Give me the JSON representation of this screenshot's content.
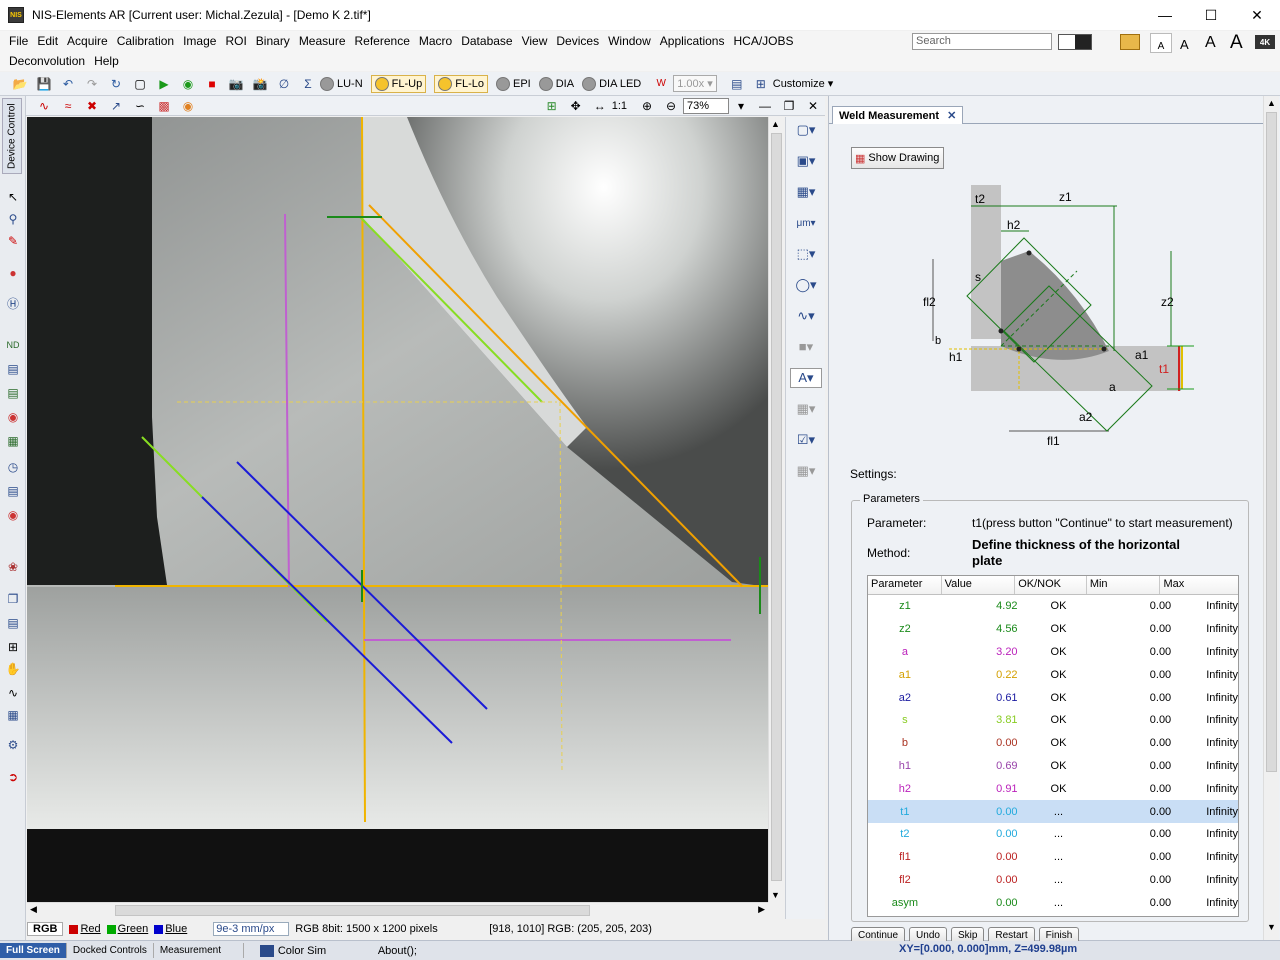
{
  "window": {
    "title": "NIS-Elements AR [Current user: Michal.Zezula]  - [Demo K 2.tif*]",
    "app_icon": "NIS"
  },
  "menu": {
    "row1": [
      "File",
      "Edit",
      "Acquire",
      "Calibration",
      "Image",
      "ROI",
      "Binary",
      "Measure",
      "Reference",
      "Macro",
      "Database",
      "View",
      "Devices",
      "Window",
      "Applications",
      "HCA/JOBS"
    ],
    "row2": [
      "Deconvolution",
      "Help"
    ],
    "search_placeholder": "Search",
    "font_sizes": [
      "A",
      "A",
      "A",
      "A"
    ],
    "badge_4k": "4K"
  },
  "toolbar1": {
    "lu_n": "LU-N",
    "fl_up": "FL-Up",
    "fl_lo": "FL-Lo",
    "epi": "EPI",
    "dia": "DIA",
    "dia_led": "DIA LED",
    "zoom_value": "1.00x",
    "customize": "Customize"
  },
  "toolbar2": {
    "one_to_one": "1:1",
    "zoom": "73%"
  },
  "left_tab": "Device Control",
  "image_status": {
    "channels": [
      "RGB",
      "Red",
      "Green",
      "Blue"
    ],
    "channel_colors": [
      "#000000",
      "#cc0000",
      "#00aa00",
      "#0000cc"
    ],
    "scale": "9e-3 mm/px",
    "info": "RGB 8bit: 1500 x 1200 pixels",
    "pixel": "[918, 1010] RGB: (205, 205, 203)"
  },
  "bottom_tabs": [
    "Full Screen",
    "Docked Controls",
    "Measurement"
  ],
  "bottom_status": {
    "color_sim": "Color Sim",
    "about": "About();"
  },
  "panel": {
    "tab": "Weld Measurement",
    "show_drawing": "Show Drawing",
    "settings_label": "Settings:",
    "params_legend": "Parameters",
    "parameter_label": "Parameter:",
    "parameter_value": "t1(press button \"Continue\" to start measurement)",
    "method_label": "Method:",
    "method_value_line1": "Define thickness of the horizontal",
    "method_value_line2": "plate",
    "diagram_labels": [
      "t2",
      "z1",
      "h2",
      "s",
      "fl2",
      "z2",
      "b",
      "h1",
      "a1",
      "t1",
      "a",
      "a2",
      "fl1"
    ],
    "table": {
      "headers": [
        "Parameter",
        "Value",
        "OK/NOK",
        "Min",
        "Max"
      ],
      "rows": [
        {
          "name": "z1",
          "value": "4.92",
          "status": "OK",
          "min": "0.00",
          "max": "Infinity",
          "color": "#1a8a1a"
        },
        {
          "name": "z2",
          "value": "4.56",
          "status": "OK",
          "min": "0.00",
          "max": "Infinity",
          "color": "#1a8a1a"
        },
        {
          "name": "a",
          "value": "3.20",
          "status": "OK",
          "min": "0.00",
          "max": "Infinity",
          "color": "#bb22bb"
        },
        {
          "name": "a1",
          "value": "0.22",
          "status": "OK",
          "min": "0.00",
          "max": "Infinity",
          "color": "#d4a000"
        },
        {
          "name": "a2",
          "value": "0.61",
          "status": "OK",
          "min": "0.00",
          "max": "Infinity",
          "color": "#1a1aa0"
        },
        {
          "name": "s",
          "value": "3.81",
          "status": "OK",
          "min": "0.00",
          "max": "Infinity",
          "color": "#88cc22"
        },
        {
          "name": "b",
          "value": "0.00",
          "status": "OK",
          "min": "0.00",
          "max": "Infinity",
          "color": "#aa3322"
        },
        {
          "name": "h1",
          "value": "0.69",
          "status": "OK",
          "min": "0.00",
          "max": "Infinity",
          "color": "#9944aa"
        },
        {
          "name": "h2",
          "value": "0.91",
          "status": "OK",
          "min": "0.00",
          "max": "Infinity",
          "color": "#bb22bb"
        },
        {
          "name": "t1",
          "value": "0.00",
          "status": "...",
          "min": "0.00",
          "max": "Infinity",
          "color": "#22aadd"
        },
        {
          "name": "t2",
          "value": "0.00",
          "status": "...",
          "min": "0.00",
          "max": "Infinity",
          "color": "#22aadd"
        },
        {
          "name": "fl1",
          "value": "0.00",
          "status": "...",
          "min": "0.00",
          "max": "Infinity",
          "color": "#bb2222"
        },
        {
          "name": "fl2",
          "value": "0.00",
          "status": "...",
          "min": "0.00",
          "max": "Infinity",
          "color": "#bb2222"
        },
        {
          "name": "asym",
          "value": "0.00",
          "status": "...",
          "min": "0.00",
          "max": "Infinity",
          "color": "#1a8a1a"
        }
      ],
      "selected_index": 9
    },
    "buttons": [
      "Continue",
      "Undo",
      "Skip",
      "Restart",
      "Finish"
    ],
    "status": "XY=[0.000, 0.000]mm, Z=499.98µm"
  }
}
